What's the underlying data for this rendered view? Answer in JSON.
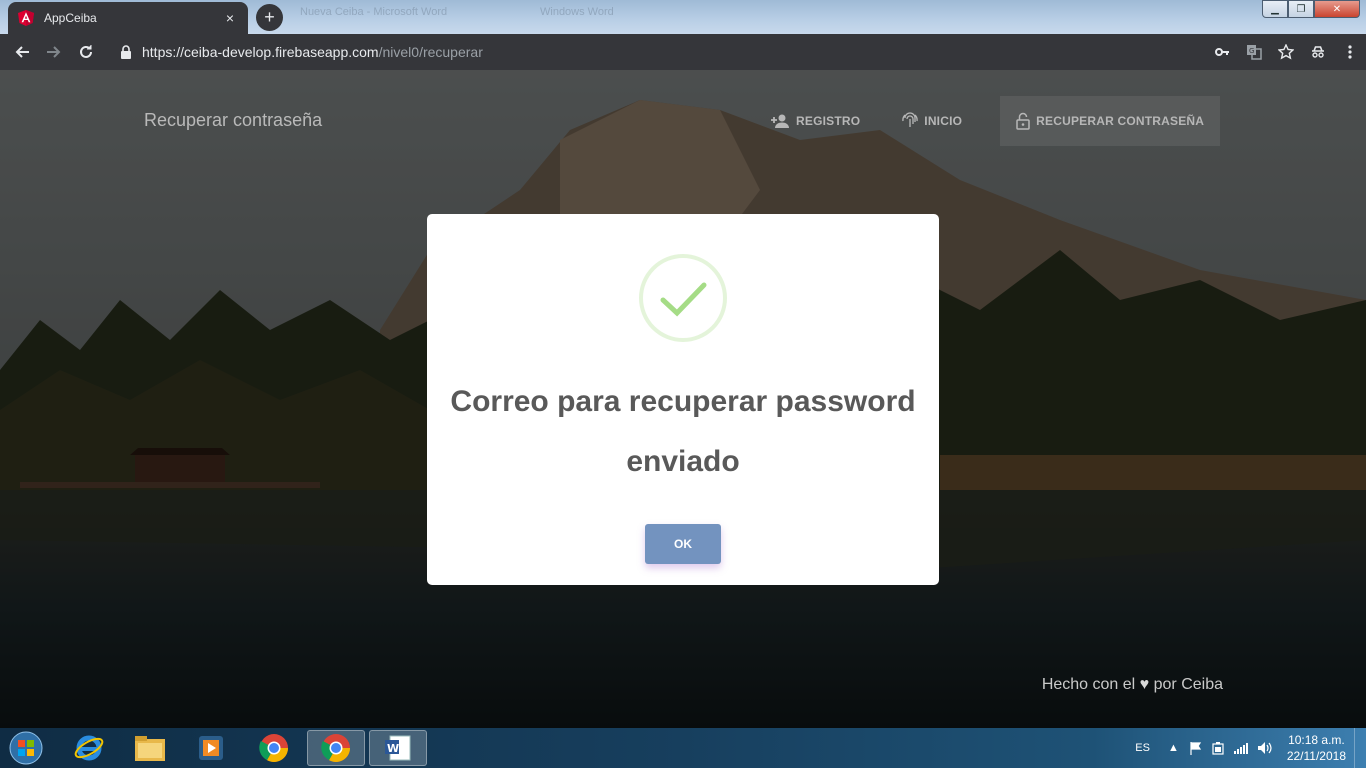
{
  "browser": {
    "tab_title": "AppCeiba",
    "tab_close": "×",
    "new_tab": "+",
    "url_host": "https://ceiba-develop.firebaseapp.com",
    "url_path": "/nivel0/recuperar"
  },
  "header": {
    "brand": "Recuperar contraseña",
    "nav": [
      {
        "label": "REGISTRO",
        "icon": "person-add-icon"
      },
      {
        "label": "INICIO",
        "icon": "fingerprint-icon"
      },
      {
        "label": "RECUPERAR CONTRASEÑA",
        "icon": "lock-open-icon"
      }
    ]
  },
  "modal": {
    "title": "Correo para recuperar password enviado",
    "ok_label": "OK",
    "success_color": "#a5dc86"
  },
  "footer": {
    "before": "Hecho con el",
    "heart": "♥",
    "after": "por Ceiba"
  },
  "taskbar": {
    "apps": [
      "internet-explorer",
      "file-explorer",
      "media-player",
      "chrome",
      "chrome-active",
      "word"
    ],
    "lang": "ES",
    "time": "10:18 a.m.",
    "date": "22/11/2018"
  },
  "colors": {
    "ok_button": "#7393bf",
    "toolbar": "#35363a"
  }
}
